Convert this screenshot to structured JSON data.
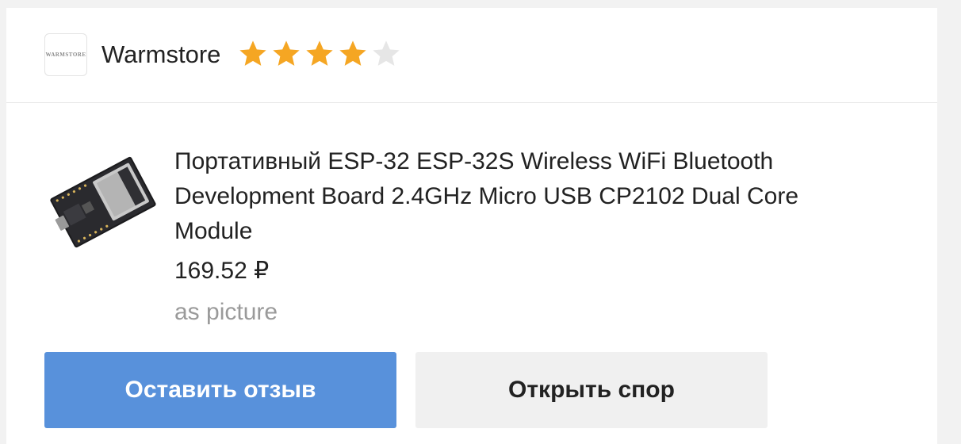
{
  "store": {
    "logo_text": "WARMSTORE",
    "name": "Warmstore",
    "rating": {
      "stars_total": 5,
      "stars_filled": 4,
      "filled_color": "#f5a623",
      "empty_color": "#e6e6e6"
    }
  },
  "product": {
    "image_icon": "esp32-board-image",
    "title": "Портативный ESP-32 ESP-32S Wireless WiFi Bluetooth Development Board 2.4GHz Micro USB CP2102 Dual Core Module",
    "price": "169.52 ₽",
    "variant": "as picture"
  },
  "actions": {
    "leave_review_label": "Оставить отзыв",
    "open_dispute_label": "Открыть спор"
  },
  "colors": {
    "primary_button": "#5891db",
    "secondary_button": "#f0f0f0"
  }
}
